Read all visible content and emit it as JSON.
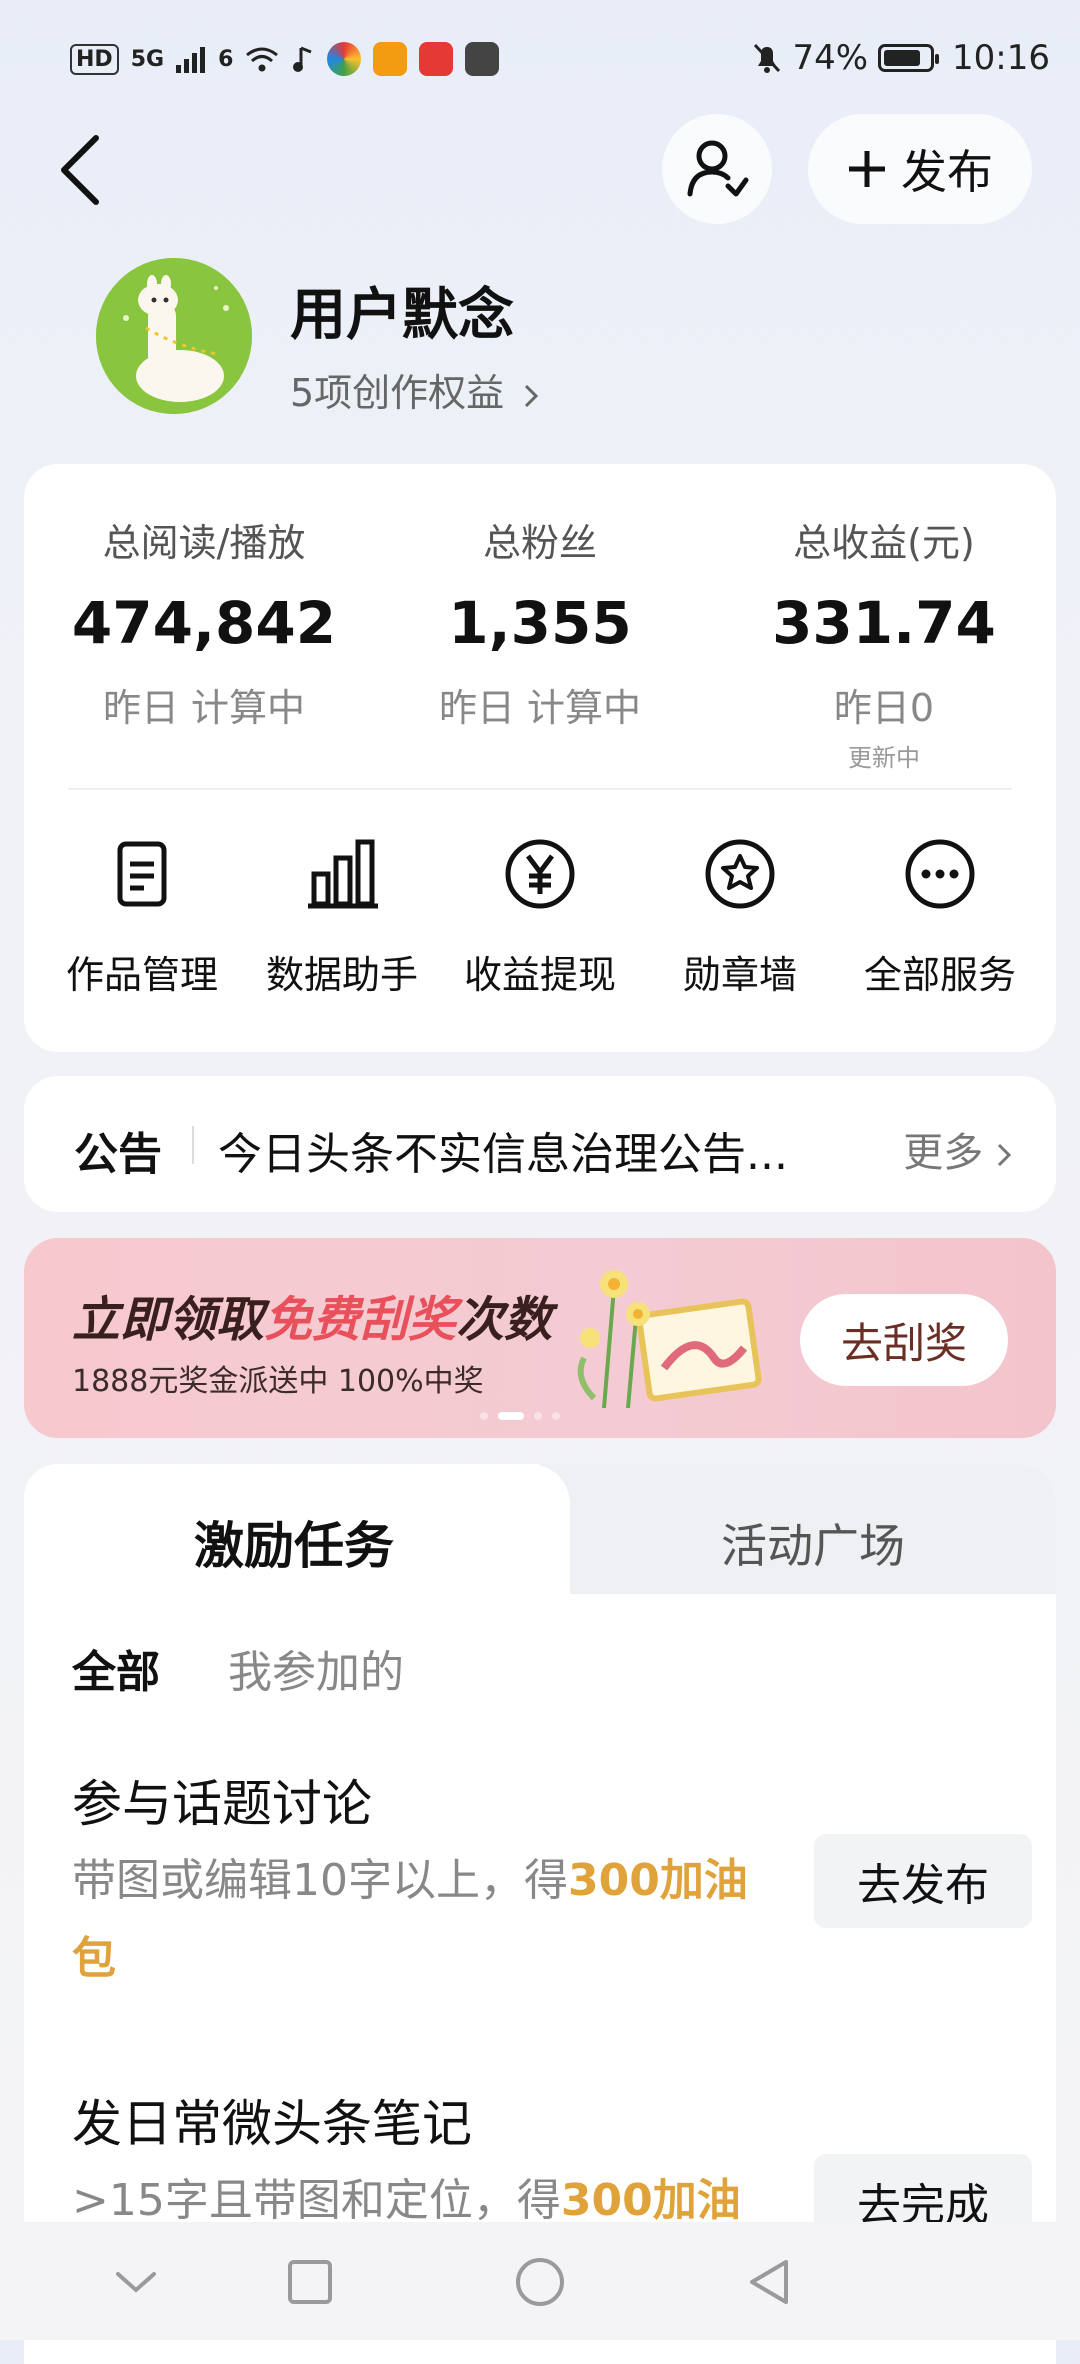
{
  "status_bar": {
    "hd": "HD",
    "signal1": "5G",
    "signal2": "6",
    "battery_pct": "74%",
    "time": "10:16"
  },
  "header": {
    "back_icon": "chevron-left-icon",
    "follow_icon": "user-check-icon",
    "publish_label": "发布"
  },
  "profile": {
    "name": "用户默念",
    "rights": "5项创作权益"
  },
  "stats": [
    {
      "label": "总阅读/播放",
      "value": "474,842",
      "sub": "昨日 计算中",
      "tiny": ""
    },
    {
      "label": "总粉丝",
      "value": "1,355",
      "sub": "昨日 计算中",
      "tiny": ""
    },
    {
      "label": "总收益(元)",
      "value": "331.74",
      "sub": "昨日0",
      "tiny": "更新中"
    }
  ],
  "services": [
    {
      "label": "作品管理",
      "icon": "document-icon"
    },
    {
      "label": "数据助手",
      "icon": "bar-chart-icon"
    },
    {
      "label": "收益提现",
      "icon": "yuan-icon"
    },
    {
      "label": "勋章墙",
      "icon": "medal-icon"
    },
    {
      "label": "全部服务",
      "icon": "more-icon"
    }
  ],
  "notice": {
    "title": "公告",
    "text": "今日头条不实信息治理公告...",
    "more": "更多"
  },
  "banner": {
    "title_a": "立即领取",
    "title_hl": "免费刮奖",
    "title_b": "次数",
    "subtitle": "1888元奖金派送中 100%中奖",
    "button": "去刮奖"
  },
  "tasks": {
    "tabs": [
      "激励任务",
      "活动广场"
    ],
    "filters": [
      "全部",
      "我参加的"
    ],
    "items": [
      {
        "title": "参与话题讨论",
        "desc": "带图或编辑10字以上，得",
        "reward": "300加油包",
        "button": "去发布"
      },
      {
        "title": "发日常微头条笔记",
        "desc": ">15字且带图和定位，得",
        "reward": "300加油",
        "button": "去完成"
      }
    ]
  },
  "nav": [
    "chevron-down-icon",
    "square-icon",
    "circle-icon",
    "triangle-back-icon"
  ]
}
